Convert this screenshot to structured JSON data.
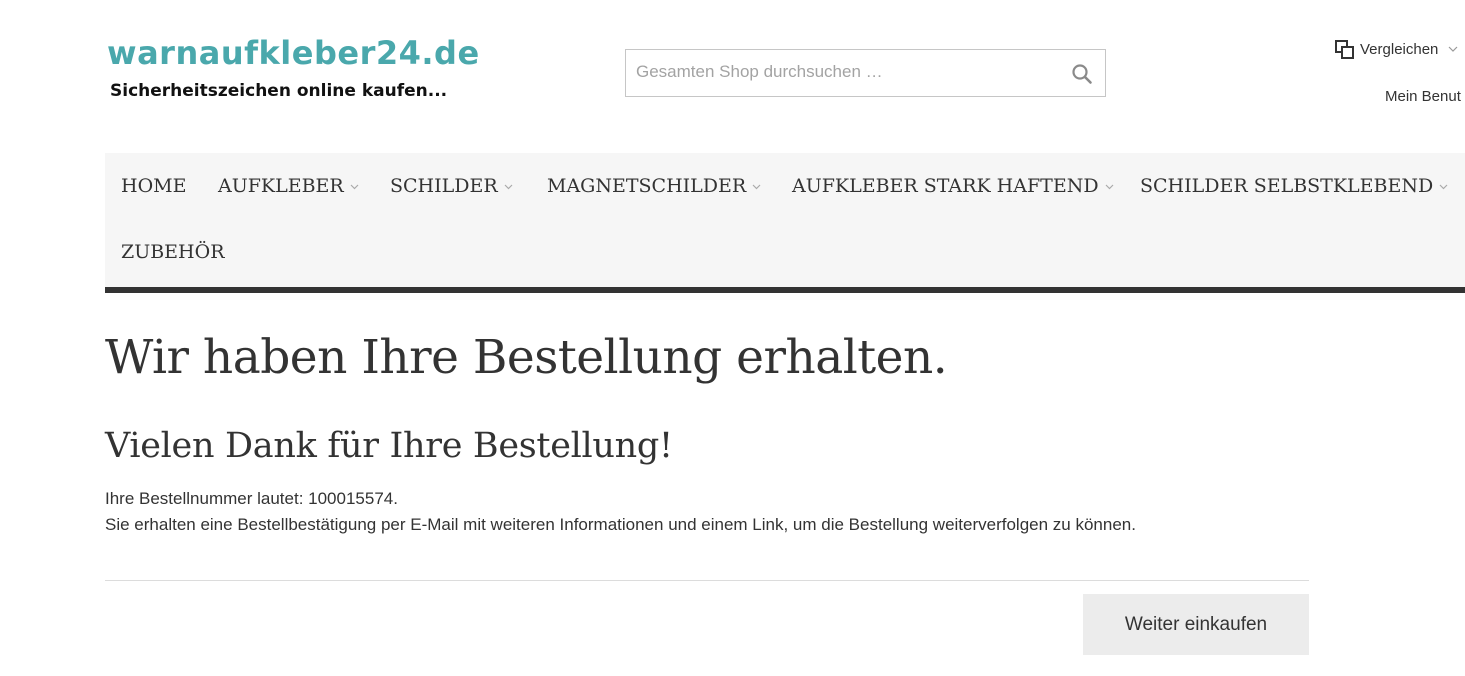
{
  "header": {
    "logo_title": "warnaufkleber24.de",
    "logo_subtitle": "Sicherheitszeichen online kaufen...",
    "search_placeholder": "Gesamten Shop durchsuchen …",
    "search_icon": "search-icon",
    "compare_label": "Vergleichen",
    "account_label": "Mein Benut"
  },
  "nav": {
    "items": [
      {
        "label": "HOME",
        "has_dropdown": false
      },
      {
        "label": "AUFKLEBER",
        "has_dropdown": true
      },
      {
        "label": "SCHILDER",
        "has_dropdown": true
      },
      {
        "label": "MAGNETSCHILDER",
        "has_dropdown": true
      },
      {
        "label": "AUFKLEBER STARK HAFTEND",
        "has_dropdown": true
      },
      {
        "label": "SCHILDER SELBSTKLEBEND",
        "has_dropdown": true
      },
      {
        "label": "ZUBEHÖR",
        "has_dropdown": false
      }
    ]
  },
  "main": {
    "title": "Wir haben Ihre Bestellung erhalten.",
    "subtitle": "Vielen Dank für Ihre Bestellung!",
    "order_number_text": "Ihre Bestellnummer lautet: 100015574.",
    "confirmation_text": "Sie erhalten eine Bestellbestätigung per E-Mail mit weiteren Informationen und einem Link, um die Bestellung weiterverfolgen zu können.",
    "continue_button": "Weiter einkaufen"
  },
  "colors": {
    "brand": "#4aa8ac",
    "nav_background": "#f6f6f6",
    "nav_border": "#333333",
    "button_background": "#ececec",
    "text": "#333333"
  }
}
